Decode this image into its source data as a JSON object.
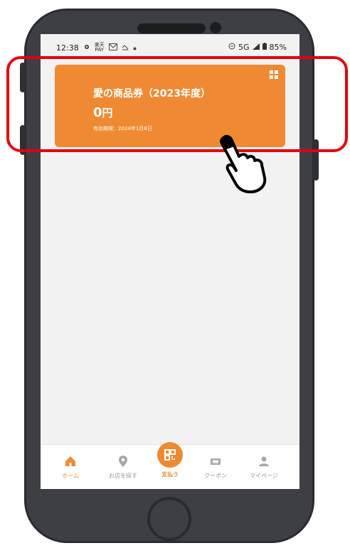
{
  "status": {
    "time": "12:38",
    "pay_top": "楽天",
    "pay_bottom": "PAY",
    "network": "5G",
    "battery": "85%"
  },
  "card": {
    "title": "愛の商品券（2023年度）",
    "amount": "0",
    "unit": "円",
    "expiry": "有効期限：2024年1月8日"
  },
  "nav": {
    "items": [
      {
        "label": "ホーム",
        "icon": "home-icon"
      },
      {
        "label": "お店を探す",
        "icon": "location-pin-icon"
      },
      {
        "label": "支払う",
        "icon": "qr-pay-icon"
      },
      {
        "label": "クーポン",
        "icon": "ticket-icon"
      },
      {
        "label": "マイページ",
        "icon": "user-icon"
      }
    ]
  },
  "colors": {
    "accent": "#f08a32",
    "highlight": "#e3000f",
    "phone": "#3d3f45"
  }
}
